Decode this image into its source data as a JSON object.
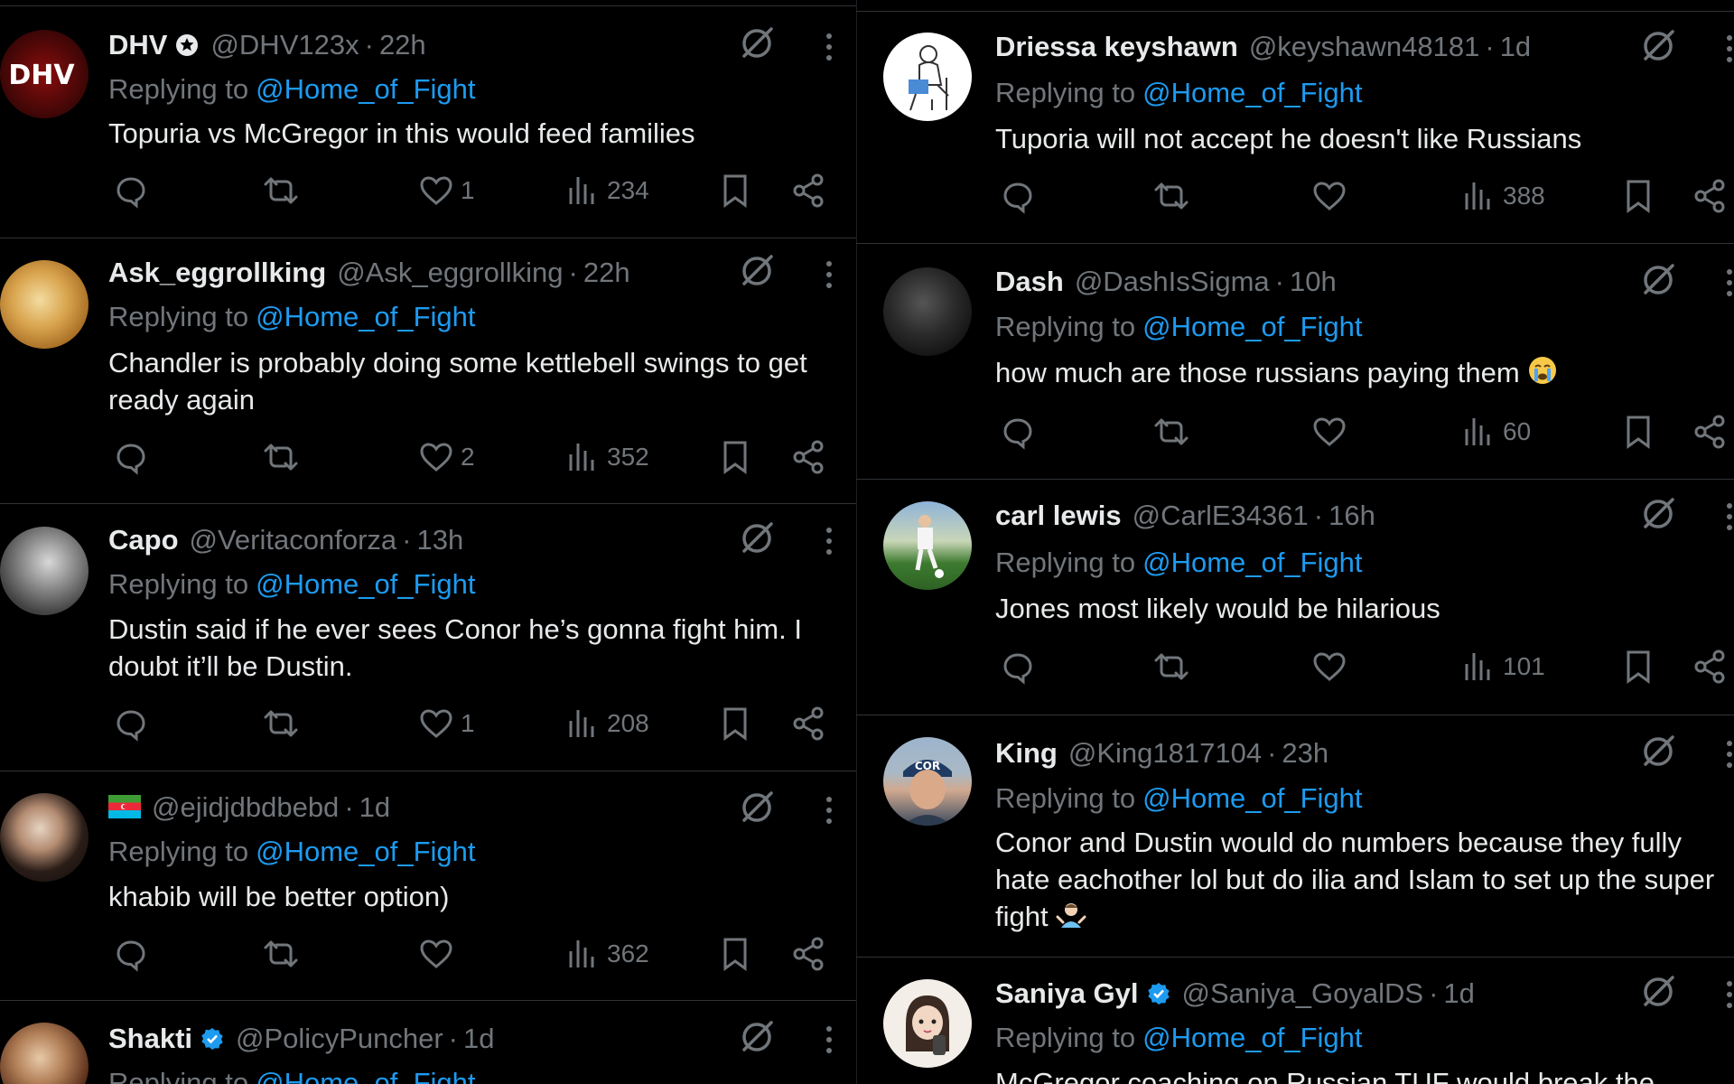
{
  "replying_label": "Replying to",
  "reply_target": "@Home_of_Fight",
  "left_column": [
    {
      "name": "DHV",
      "handle": "@DHV123x",
      "time": "22h",
      "text": "Topuria vs McGregor in this would feed families",
      "likes": "1",
      "views": "234",
      "avatar": "DHV",
      "verified": "gray"
    },
    {
      "name": "Ask_eggrollking",
      "handle": "@Ask_eggrollking",
      "time": "22h",
      "text": "Chandler is probably doing some kettlebell swings to get ready again",
      "likes": "2",
      "views": "352",
      "avatar": "food",
      "verified": ""
    },
    {
      "name": "Capo",
      "handle": "@Veritaconforza",
      "time": "13h",
      "text": "Dustin said if he ever sees Conor he’s gonna fight him. I doubt it’ll be Dustin.",
      "likes": "1",
      "views": "208",
      "avatar": "hooded",
      "verified": ""
    },
    {
      "name": "",
      "handle": "@ejidjdbdbebd",
      "time": "1d",
      "text": "khabib will be better option)",
      "likes": "",
      "views": "362",
      "avatar": "person",
      "verified": "",
      "flag": "azerbaijan-flag"
    },
    {
      "name": "Shakti",
      "handle": "@PolicyPuncher",
      "time": "1d",
      "text": "",
      "likes": "",
      "views": "",
      "avatar": "person2",
      "verified": "blue"
    }
  ],
  "right_column": [
    {
      "name": "Driessa keyshawn",
      "handle": "@keyshawn48181",
      "time": "1d",
      "text": "Tuporia will not accept he doesn't like Russians",
      "likes": "",
      "views": "388",
      "avatar": "sketch",
      "verified": ""
    },
    {
      "name": "Dash",
      "handle": "@DashIsSigma",
      "time": "10h",
      "text": "how much are those russians paying them",
      "likes": "",
      "views": "60",
      "avatar": "dark",
      "verified": "",
      "emoji": "crying-face"
    },
    {
      "name": "carl lewis",
      "handle": "@CarlE34361",
      "time": "16h",
      "text": "Jones most likely would be hilarious",
      "likes": "",
      "views": "101",
      "avatar": "soccer",
      "verified": ""
    },
    {
      "name": "King",
      "handle": "@King1817104",
      "time": "23h",
      "text": "Conor and Dustin would do numbers because they fully hate eachother lol but do ilia and Islam to set up the super fight",
      "likes": "",
      "views": "",
      "avatar": "cap",
      "verified": "",
      "emoji": "shrug"
    },
    {
      "name": "Saniya Gyl",
      "handle": "@Saniya_GoyalDS",
      "time": "1d",
      "text": "McGregor coaching on Russian TUF would break the",
      "likes": "",
      "views": "",
      "avatar": "cartoon",
      "verified": "blue"
    }
  ],
  "colors": {
    "background": "#000000",
    "text": "#e7e9ea",
    "muted": "#71767b",
    "link": "#1d9bf0",
    "divider": "#2f3336"
  },
  "icons": [
    "reply-icon",
    "retweet-icon",
    "like-icon",
    "views-icon",
    "bookmark-icon",
    "share-icon",
    "grok-icon",
    "more-icon"
  ]
}
